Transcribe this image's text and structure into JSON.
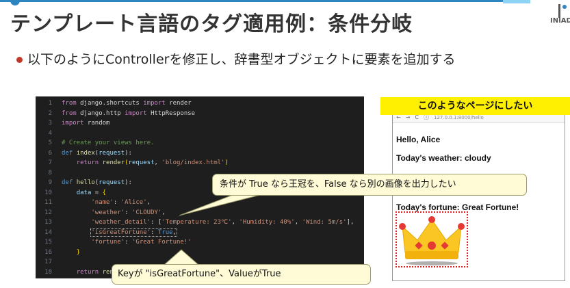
{
  "slide": {
    "title": "テンプレート言語のタグ適用例：条件分岐",
    "bullet": "以下のようにControllerを修正し、辞書型オブジェクトに要素を追加する",
    "logo_text": "INIAD"
  },
  "code_lines": [
    {
      "n": "1",
      "html": "<span class=\"kw\">from</span> django.shortcuts <span class=\"kw\">import</span> render"
    },
    {
      "n": "2",
      "html": "<span class=\"kw\">from</span> django.http <span class=\"kw\">import</span> HttpResponse"
    },
    {
      "n": "3",
      "html": "<span class=\"kw\">import</span> random"
    },
    {
      "n": "4",
      "html": ""
    },
    {
      "n": "5",
      "html": "<span class=\"cmt\"># Create your views here.</span>"
    },
    {
      "n": "6",
      "html": "<span class=\"kw2\">def</span> <span class=\"fn\">index</span>(<span class=\"var\">request</span>):"
    },
    {
      "n": "7",
      "html": "    <span class=\"kw\">return</span> <span class=\"fn\">render</span><span class=\"brace\">(</span><span class=\"var\">request</span>, <span class=\"str\">'blog/index.html'</span><span class=\"brace\">)</span>"
    },
    {
      "n": "8",
      "html": ""
    },
    {
      "n": "9",
      "html": "<span class=\"kw2\">def</span> <span class=\"fn\">hello</span>(<span class=\"var\">request</span>):"
    },
    {
      "n": "10",
      "html": "    <span class=\"var\">data</span> = <span class=\"brace\">{</span>"
    },
    {
      "n": "11",
      "html": "        <span class=\"str\">'name'</span>: <span class=\"str\">'Alice'</span>,"
    },
    {
      "n": "12",
      "html": "        <span class=\"str\">'weather'</span>: <span class=\"str\">'CLOUDY'</span>,"
    },
    {
      "n": "13",
      "html": "        <span class=\"str\">'weather_detail'</span>: [<span class=\"str\">'Temperature: 23℃'</span>, <span class=\"str\">'Humidity: 40%'</span>, <span class=\"str\">'Wind: 5m/s'</span>],"
    },
    {
      "n": "14",
      "html": "        <span class=\"dotbox\"><span class=\"str\">'isGreatFortune'</span>: <span class=\"kw2\">True</span>,</span>"
    },
    {
      "n": "15",
      "html": "        <span class=\"str\">'fortune'</span>: <span class=\"str\">'Great Fortune!'</span>"
    },
    {
      "n": "16",
      "html": "    <span class=\"brace\">}</span>"
    },
    {
      "n": "17",
      "html": ""
    },
    {
      "n": "18",
      "html": "    <span class=\"kw\">return</span> <span class=\"fn\">ren</span>"
    }
  ],
  "preview": {
    "banner": "このようなページにしたい",
    "url": "127.0.0.1:8000/hello",
    "hello": "Hello, Alice",
    "weather": "Today's weather: cloudy",
    "fortune": "Today's fortune: Great Fortune!"
  },
  "callouts": {
    "condition": "条件が True なら王冠を、False なら別の画像を出力したい",
    "key_value": "Keyが \"isGreatFortune\"、ValueがTrue"
  },
  "colors": {
    "accent": "#2e86c1",
    "banner": "#ffef00",
    "callout_bg": "#fffbd6",
    "editor_bg": "#1e1e1e",
    "dotted_border": "#e02020"
  }
}
